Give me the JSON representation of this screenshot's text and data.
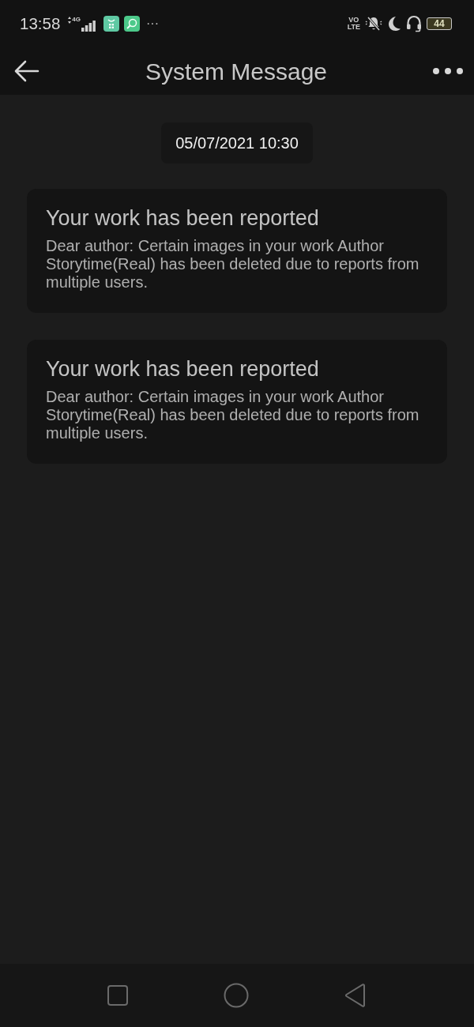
{
  "status_bar": {
    "time": "13:58",
    "network": "4G",
    "more": "···",
    "volte": "VO LTE",
    "battery": "44"
  },
  "header": {
    "title": "System Message"
  },
  "date_stamp": "05/07/2021 10:30",
  "messages": [
    {
      "title": "Your work has been reported",
      "body": "Dear author: Certain images in your work Author Storytime(Real) has been deleted due to reports from multiple users."
    },
    {
      "title": "Your work has been reported",
      "body": "Dear author: Certain images in your work Author Storytime(Real) has been deleted due to reports from multiple users."
    }
  ]
}
